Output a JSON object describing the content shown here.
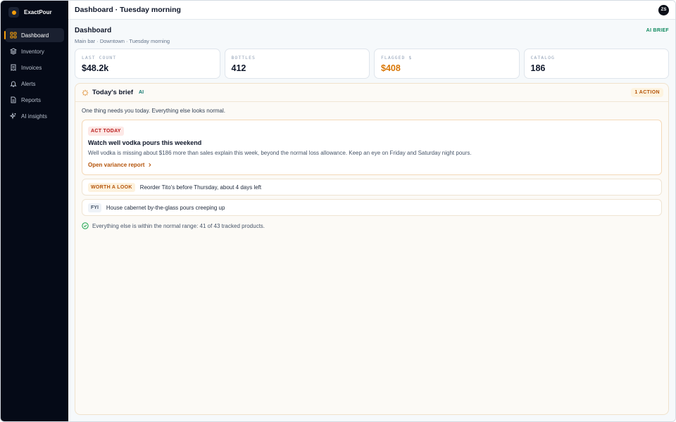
{
  "app": {
    "name": "ExactPour"
  },
  "topbar": {
    "title": "Dashboard · Tuesday morning",
    "avatar_initials": "ZS"
  },
  "sidebar": {
    "items": [
      {
        "label": "Dashboard",
        "icon": "grid-icon",
        "active": true
      },
      {
        "label": "Inventory",
        "icon": "stack-icon"
      },
      {
        "label": "Invoices",
        "icon": "invoice-icon"
      },
      {
        "label": "Alerts",
        "icon": "bell-icon"
      },
      {
        "label": "Reports",
        "icon": "document-icon"
      },
      {
        "label": "AI insights",
        "icon": "sparkle-icon"
      }
    ]
  },
  "page": {
    "title": "Dashboard",
    "subtitle": "Main bar · Downtown · Tuesday morning",
    "badge": "AI BRIEF"
  },
  "stats": [
    {
      "label": "LAST COUNT",
      "value": "$48.2k"
    },
    {
      "label": "BOTTLES",
      "value": "412"
    },
    {
      "label": "FLAGGED $",
      "value": "$408",
      "color": "#d97706"
    },
    {
      "label": "CATALOG",
      "value": "186"
    }
  ],
  "brief": {
    "title": "Today's brief",
    "ai_tag": "AI",
    "action_count": "1 ACTION",
    "lead": "One thing needs you today. Everything else looks normal.",
    "act": {
      "badge": "ACT TODAY",
      "title": "Watch well vodka pours this weekend",
      "description": "Well vodka is missing about $186 more than sales explain this week, beyond the normal loss allowance. Keep an eye on Friday and Saturday night pours.",
      "link": "Open variance report"
    },
    "worth": {
      "badge": "WORTH A LOOK",
      "text": "Reorder Tito's before Thursday, about 4 days left"
    },
    "fyi": {
      "badge": "FYI",
      "text": "House cabernet by-the-glass pours creeping up"
    },
    "ok": "Everything else is within the normal range: 41 of 43 tracked products."
  },
  "colors": {
    "accent": "#f59e0b",
    "sidebar_bg": "#050a17",
    "warn": "#d97706",
    "success": "#16a34a"
  }
}
